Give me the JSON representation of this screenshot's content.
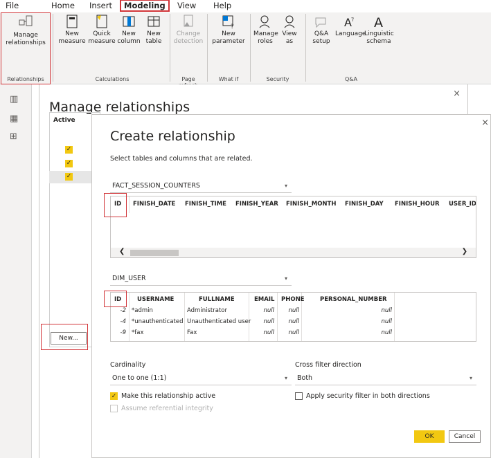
{
  "menu": [
    "File",
    "Home",
    "Insert",
    "Modeling",
    "View",
    "Help"
  ],
  "ribbon": {
    "manage_relationships": "Manage relationships",
    "new_measure": "New measure",
    "quick_measure": "Quick measure",
    "new_column": "New column",
    "new_table": "New table",
    "change_detection": "Change detection",
    "new_parameter": "New parameter",
    "manage_roles": "Manage roles",
    "view_as": "View as",
    "qa_setup": "Q&A setup",
    "language": "Language",
    "linguistic_schema": "Linguistic schema",
    "groups": {
      "relationships": "Relationships",
      "calculations": "Calculations",
      "page_refresh": "Page refresh",
      "what_if": "What if",
      "security": "Security",
      "qa": "Q&A"
    }
  },
  "manage": {
    "title": "Manage relationships",
    "active_header": "Active",
    "new_button": "New...",
    "close": "×"
  },
  "create": {
    "title": "Create relationship",
    "subtitle": "Select tables and columns that are related.",
    "close": "×",
    "table1": {
      "name": "FACT_SESSION_COUNTERS",
      "columns": [
        "ID",
        "FINISH_DATE",
        "FINISH_TIME",
        "FINISH_YEAR",
        "FINISH_MONTH",
        "FINISH_DAY",
        "FINISH_HOUR",
        "USER_ID"
      ]
    },
    "table2": {
      "name": "DIM_USER",
      "columns": [
        "ID",
        "USERNAME",
        "FULLNAME",
        "EMAIL",
        "PHONE",
        "PERSONAL_NUMBER"
      ],
      "rows": [
        [
          "-2",
          "*admin",
          "Administrator",
          "null",
          "null",
          "null"
        ],
        [
          "-4",
          "*unauthenticated",
          "Unauthenticated user",
          "null",
          "null",
          "null"
        ],
        [
          "-9",
          "*fax",
          "Fax",
          "null",
          "null",
          "null"
        ]
      ]
    },
    "cardinality_label": "Cardinality",
    "cardinality_value": "One to one (1:1)",
    "cross_filter_label": "Cross filter direction",
    "cross_filter_value": "Both",
    "make_active": "Make this relationship active",
    "apply_security": "Apply security filter in both directions",
    "assume_integrity": "Assume referential integrity",
    "ok": "OK",
    "cancel": "Cancel"
  }
}
